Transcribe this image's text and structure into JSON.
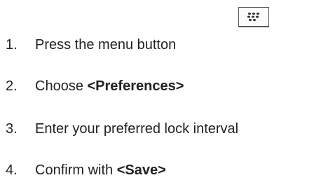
{
  "steps": [
    {
      "number": "1.",
      "text": "Press the menu button",
      "emphasis": ""
    },
    {
      "number": "2.",
      "text": "Choose ",
      "emphasis": "<Preferences>"
    },
    {
      "number": "3.",
      "text": "Enter your preferred lock interval",
      "emphasis": ""
    },
    {
      "number": "4.",
      "text": "Confirm with ",
      "emphasis": "<Save>"
    }
  ],
  "menu_key_icon": "blackberry-menu-key-icon"
}
